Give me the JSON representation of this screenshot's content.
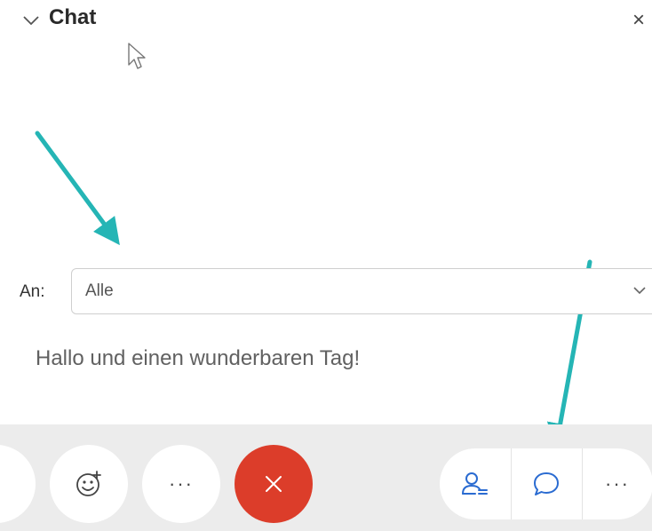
{
  "chat_panel": {
    "title": "Chat",
    "collapse_icon": "chevron-down-icon",
    "close_glyph": "×",
    "close_icon": "close-icon"
  },
  "recipient": {
    "label": "An:",
    "selected": "Alle",
    "dropdown_icon": "chevron-down-icon"
  },
  "message": {
    "text": "Hallo und einen wunderbaren Tag!"
  },
  "toolbar": {
    "buttons": [
      {
        "icon": "partial-button"
      },
      {
        "icon": "emoji-reaction-icon"
      },
      {
        "icon": "more-options-icon",
        "glyph": "···"
      },
      {
        "icon": "leave-meeting-icon",
        "color": "#dc3d2a"
      }
    ],
    "right_group": [
      {
        "icon": "participants-icon"
      },
      {
        "icon": "chat-bubble-icon"
      },
      {
        "icon": "more-options-icon",
        "glyph": "···"
      }
    ]
  },
  "colors": {
    "accent_blue": "#2a6bd1",
    "annotation_arrow": "#25b5b5",
    "leave_red": "#dc3d2a",
    "toolbar_bg": "#ececec"
  }
}
